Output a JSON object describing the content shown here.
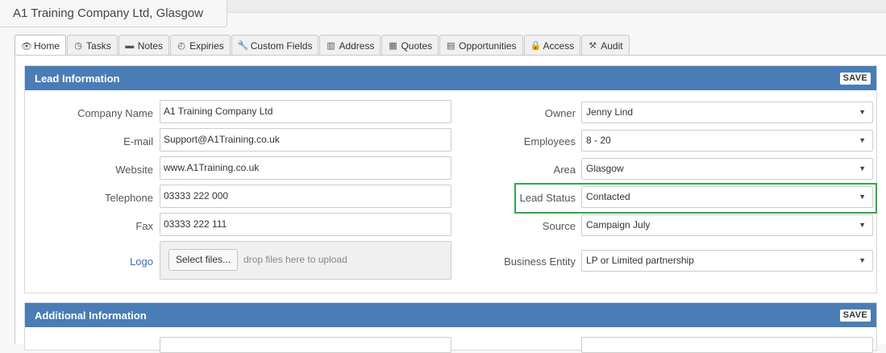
{
  "window": {
    "title": "A1 Training Company Ltd, Glasgow"
  },
  "tabs": [
    {
      "label": "Home",
      "icon": "eye-icon",
      "glyph": "👁"
    },
    {
      "label": "Tasks",
      "icon": "clock-icon",
      "glyph": "◷"
    },
    {
      "label": "Notes",
      "icon": "comment-icon",
      "glyph": "▬"
    },
    {
      "label": "Expiries",
      "icon": "stopwatch-icon",
      "glyph": "◴"
    },
    {
      "label": "Custom Fields",
      "icon": "wrench-icon",
      "glyph": "🔧"
    },
    {
      "label": "Address",
      "icon": "building-icon",
      "glyph": "▥"
    },
    {
      "label": "Quotes",
      "icon": "calculator-icon",
      "glyph": "▦"
    },
    {
      "label": "Opportunities",
      "icon": "book-icon",
      "glyph": "▤"
    },
    {
      "label": "Access",
      "icon": "lock-icon",
      "glyph": "🔒"
    },
    {
      "label": "Audit",
      "icon": "gavel-icon",
      "glyph": "⚒"
    }
  ],
  "lead_info": {
    "title": "Lead Information",
    "save_label": "SAVE",
    "company_name": {
      "label": "Company Name",
      "value": "A1 Training Company Ltd"
    },
    "email": {
      "label": "E-mail",
      "value": "Support@A1Training.co.uk"
    },
    "website": {
      "label": "Website",
      "value": "www.A1Training.co.uk"
    },
    "telephone": {
      "label": "Telephone",
      "value": "03333 222 000"
    },
    "fax": {
      "label": "Fax",
      "value": "03333 222 111"
    },
    "logo": {
      "label": "Logo",
      "button": "Select files...",
      "hint": "drop files here to upload"
    },
    "owner": {
      "label": "Owner",
      "value": "Jenny Lind"
    },
    "employees": {
      "label": "Employees",
      "value": "8 - 20"
    },
    "area": {
      "label": "Area",
      "value": "Glasgow"
    },
    "lead_status": {
      "label": "Lead Status",
      "value": "Contacted",
      "highlight_color": "#2ea84a"
    },
    "source": {
      "label": "Source",
      "value": "Campaign July"
    },
    "business_entity": {
      "label": "Business Entity",
      "value": "LP or Limited partnership"
    }
  },
  "additional_info": {
    "title": "Additional Information",
    "save_label": "SAVE"
  },
  "colors": {
    "panel_header": "#4a7db6",
    "link": "#3a70ad"
  }
}
